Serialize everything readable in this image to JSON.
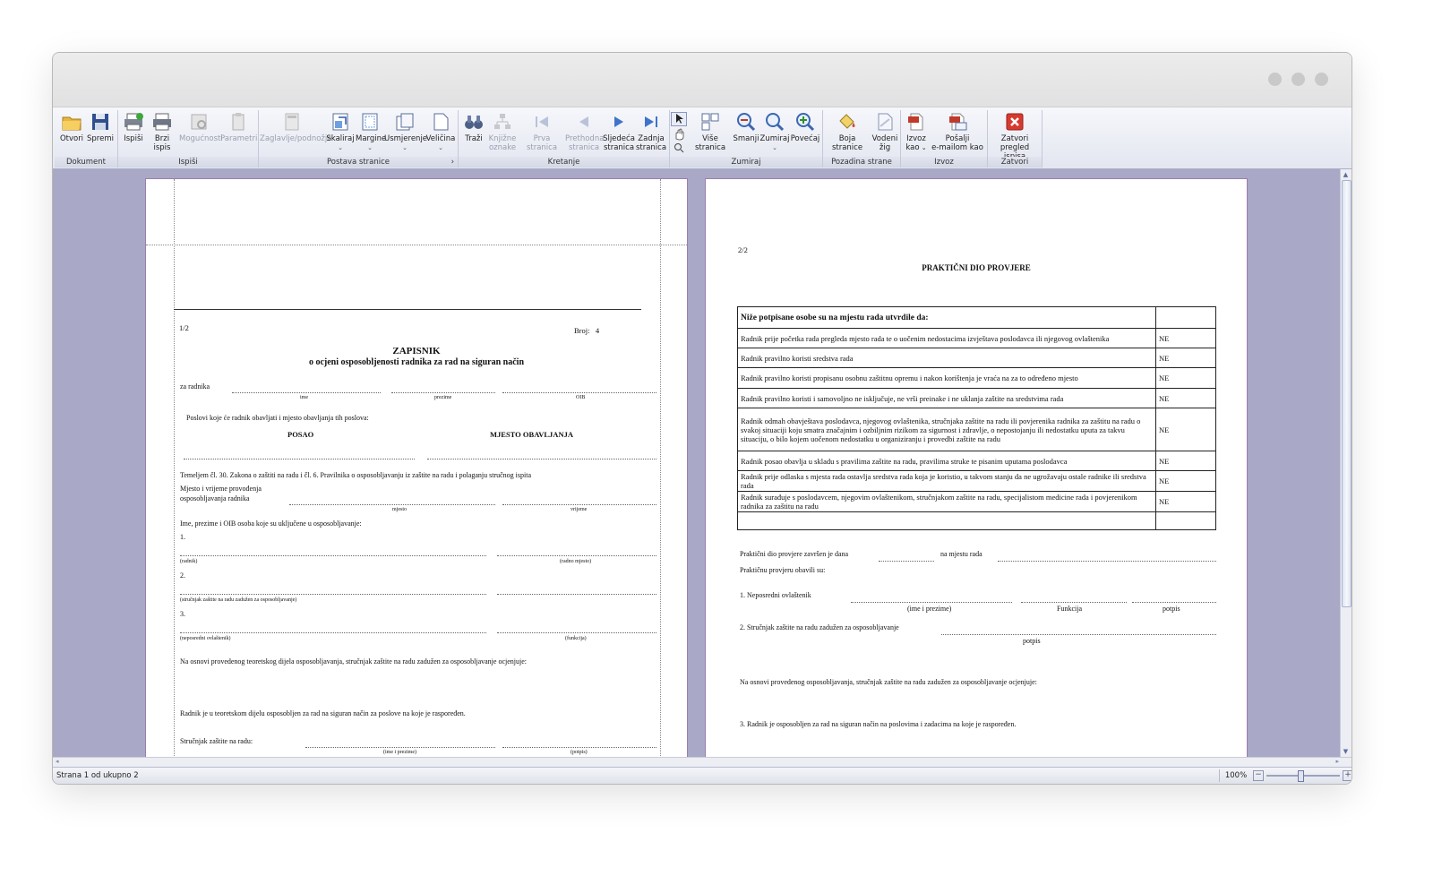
{
  "ribbon": {
    "buttons": {
      "otvori": "Otvori",
      "spremi": "Spremi",
      "ispisi": "Ispiši",
      "brzi_ispis": "Brzi ispis",
      "mogucnosti": "Mogućnosti",
      "parametri": "Parametri",
      "zaglavlje": "Zaglavlje/podnožje",
      "skaliraj": "Skaliraj",
      "margine": "Margine",
      "usmjerenje": "Usmjerenje",
      "velicina": "Veličina",
      "trazi": "Traži",
      "knjizne_1": "Knjižne",
      "knjizne_2": "oznake",
      "prva_1": "Prva stranica",
      "prethodna_1": "Prethodna",
      "prethodna_2": "stranica",
      "sljedeca_1": "Sljedeća",
      "sljedeca_2": "stranica",
      "zadnja_1": "Zadnja",
      "zadnja_2": "stranica",
      "vise_stranica": "Više stranica",
      "smanji": "Smanji",
      "zumiraj": "Zumiraj",
      "povecaj": "Povećaj",
      "boja_stranice": "Boja stranice",
      "vodeni_1": "Vodeni",
      "vodeni_2": "žig",
      "izvoz_1": "Izvoz",
      "izvoz_2": "kao",
      "posalji_1": "Pošalji",
      "posalji_2": "e-mailom kao",
      "zatvori_1": "Zatvori",
      "zatvori_2": "pregled ispisa"
    },
    "groups": {
      "dokument": "Dokument",
      "ispisi": "Ispiši",
      "postava": "Postava stranice",
      "kretanje": "Kretanje",
      "zumiraj": "Zumiraj",
      "pozadina": "Pozadina strane",
      "izvoz": "Izvoz",
      "zatvori": "Zatvori"
    }
  },
  "page1": {
    "page_no": "1/2",
    "broj_label": "Broj:",
    "broj_value": "4",
    "title": "ZAPISNIK",
    "subtitle": "o ocjeni osposobljenosti radnika za rad na siguran način",
    "za_radnika": "za radnika",
    "ime": "ime",
    "prezime": "prezime",
    "oib": "OIB",
    "poslovi": "Poslovi koje će radnik obavljati i mjesto obavljanja tih poslova:",
    "posao": "POSAO",
    "mjesto_obavljanja": "MJESTO OBAVLJANJA",
    "temeljem": "Temeljem čl. 30. Zakona o zaštiti na radu i čl. 6. Pravilnika o osposobljavanju iz zaštite na radu i polaganju stručnog ispita",
    "mjesto_vrijeme_1": "Mjesto i vrijeme provođenja",
    "mjesto_vrijeme_2": "osposobljavanja radnika",
    "mjesto": "mjesto",
    "vrijeme": "vrijeme",
    "ime_prezime_oib": "Ime, prezime i OIB osoba koje su uključene u osposobljavanje:",
    "n1": "1.",
    "radnik": "(radnik)",
    "radno_mjesto": "(radno mjesto)",
    "n2": "2.",
    "strucnjak_zaduzen": "(stručnjak zaštite na radu zadužen za osposobljavanje)",
    "n3": "3.",
    "neposredni": "(neposredni ovlaštenik)",
    "funkcija": "(funkcija)",
    "na_osnovi": "Na osnovi provedenog teoretskog dijela osposobljavanja, stručnjak zaštite na radu zadužen za osposobljavanje ocjenjuje:",
    "radnik_je": "Radnik je u teoretskom dijelu osposobljen za rad na siguran način za poslove na koje je raspoređen.",
    "strucnjak_label": "Stručnjak zaštite na radu:",
    "ime_i_prezime": "(ime i prezime)",
    "potpis": "(potpis)"
  },
  "page2": {
    "page_no": "2/2",
    "title": "PRAKTIČNI DIO PROVJERE",
    "table_header": "Niže potpisane osobe su na mjestu rada utvrdile da:",
    "rows": [
      {
        "text": "Radnik prije početka rada pregleda mjesto rada te o uočenim nedostacima izvještava poslodavca ili njegovog ovlaštenika",
        "value": "NE"
      },
      {
        "text": "Radnik pravilno koristi sredstva rada",
        "value": "NE"
      },
      {
        "text": "Radnik pravilno koristi propisanu osobnu zaštitnu opremu i nakon korištenja je vraća na za to određeno mjesto",
        "value": "NE"
      },
      {
        "text": "Radnik pravilno koristi i samovoljno ne isključuje, ne vrši preinake i ne uklanja zaštite na sredstvima rada",
        "value": "NE"
      },
      {
        "text": "Radnik odmah obavještava poslodavca, njegovog ovlaštenika, stručnjaka zaštite na radu ili povjerenika radnika za zaštitu na radu o svakoj situaciji koju smatra značajnim i ozbiljnim rizikom za sigurnost i zdravlje, o nepostojanju ili nedostatku uputa za takvu situaciju, o bilo kojem uočenom nedostatku u organiziranju i provedbi zaštite na radu",
        "value": "NE"
      },
      {
        "text": "Radnik posao obavlja u skladu s pravilima zaštite na radu, pravilima struke te pisanim uputama poslodavca",
        "value": "NE"
      },
      {
        "text": "Radnik prije odlaska s mjesta rada ostavlja sredstva rada koja je koristio, u takvom stanju da ne ugrožavaju ostale radnike ili sredstva rada",
        "value": "NE"
      },
      {
        "text": "Radnik surađuje s poslodavcem, njegovim ovlaštenikom, stručnjakom zaštite na radu, specijalistom medicine rada i povjerenikom radnika za zaštitu na radu",
        "value": "NE"
      }
    ],
    "zavrsen": "Praktični dio provjere završen je dana",
    "na_mjestu": "na mjestu rada",
    "obavili": "Praktičnu provjeru obavili su:",
    "neposredni": "1. Neposredni ovlaštenik",
    "ime_i_prezime": "(ime i prezime)",
    "funkcija": "Funkcija",
    "potpis": "potpis",
    "strucnjak_zaduzen": "2. Stručnjak zaštite na radu zadužen za osposobljavanje",
    "potpis2": "potpis",
    "na_osnovi": "Na osnovi provedenog osposobljavanja, stručnjak zaštite na radu zadužen za osposobljavanje ocjenjuje:",
    "radnik_je": "3. Radnik je osposobljen za rad na siguran način na poslovima i zadacima na koje je raspoređen."
  },
  "status": {
    "page_info": "Strana 1 od ukupno 2",
    "zoom": "100%"
  }
}
